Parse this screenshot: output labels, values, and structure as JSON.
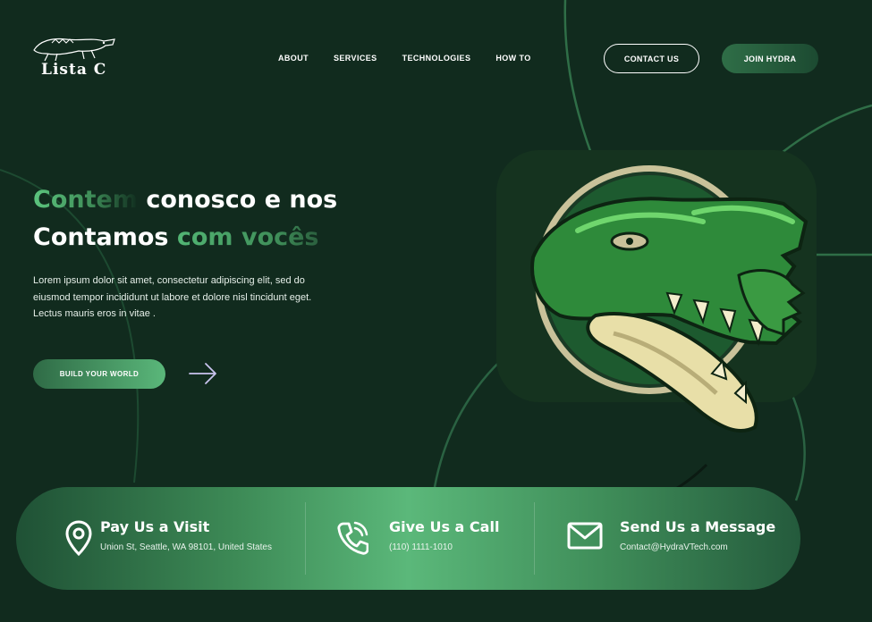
{
  "brand": {
    "logo_text": "Lista C"
  },
  "nav": {
    "items": [
      {
        "label": "ABOUT"
      },
      {
        "label": "SERVICES"
      },
      {
        "label": "TECHNOLOGIES"
      },
      {
        "label": "HOW TO"
      }
    ]
  },
  "header": {
    "contact_label": "CONTACT US",
    "join_label": "JOIN HYDRA"
  },
  "hero": {
    "headline_part1": "Contem",
    "headline_part2": " conosco e nos",
    "headline_part3": "Contamos ",
    "headline_part4": "com vocês",
    "description": "Lorem ipsum dolor sit amet, consectetur adipiscing elit, sed do eiusmod tempor incididunt ut labore et dolore nisl tincidunt eget. Lectus mauris eros in vitae .",
    "cta_label": "BUILD YOUR WORLD"
  },
  "contact": {
    "visit": {
      "title": "Pay Us a Visit",
      "detail": "Union St, Seattle, WA 98101, United States"
    },
    "call": {
      "title": "Give Us a Call",
      "detail": "(110) 1111-1010"
    },
    "message": {
      "title": "Send Us a Message",
      "detail": "Contact@HydraVTech.com"
    }
  },
  "colors": {
    "background": "#112b1e",
    "accent": "#5ab77a",
    "accent_dark": "#2f6b46"
  },
  "icons": {
    "logo": "crocodile-logo-icon",
    "cta_arrow": "arrow-right-icon",
    "visit": "map-pin-icon",
    "call": "phone-icon",
    "message": "mail-icon",
    "mascot": "crocodile-mascot-image"
  }
}
